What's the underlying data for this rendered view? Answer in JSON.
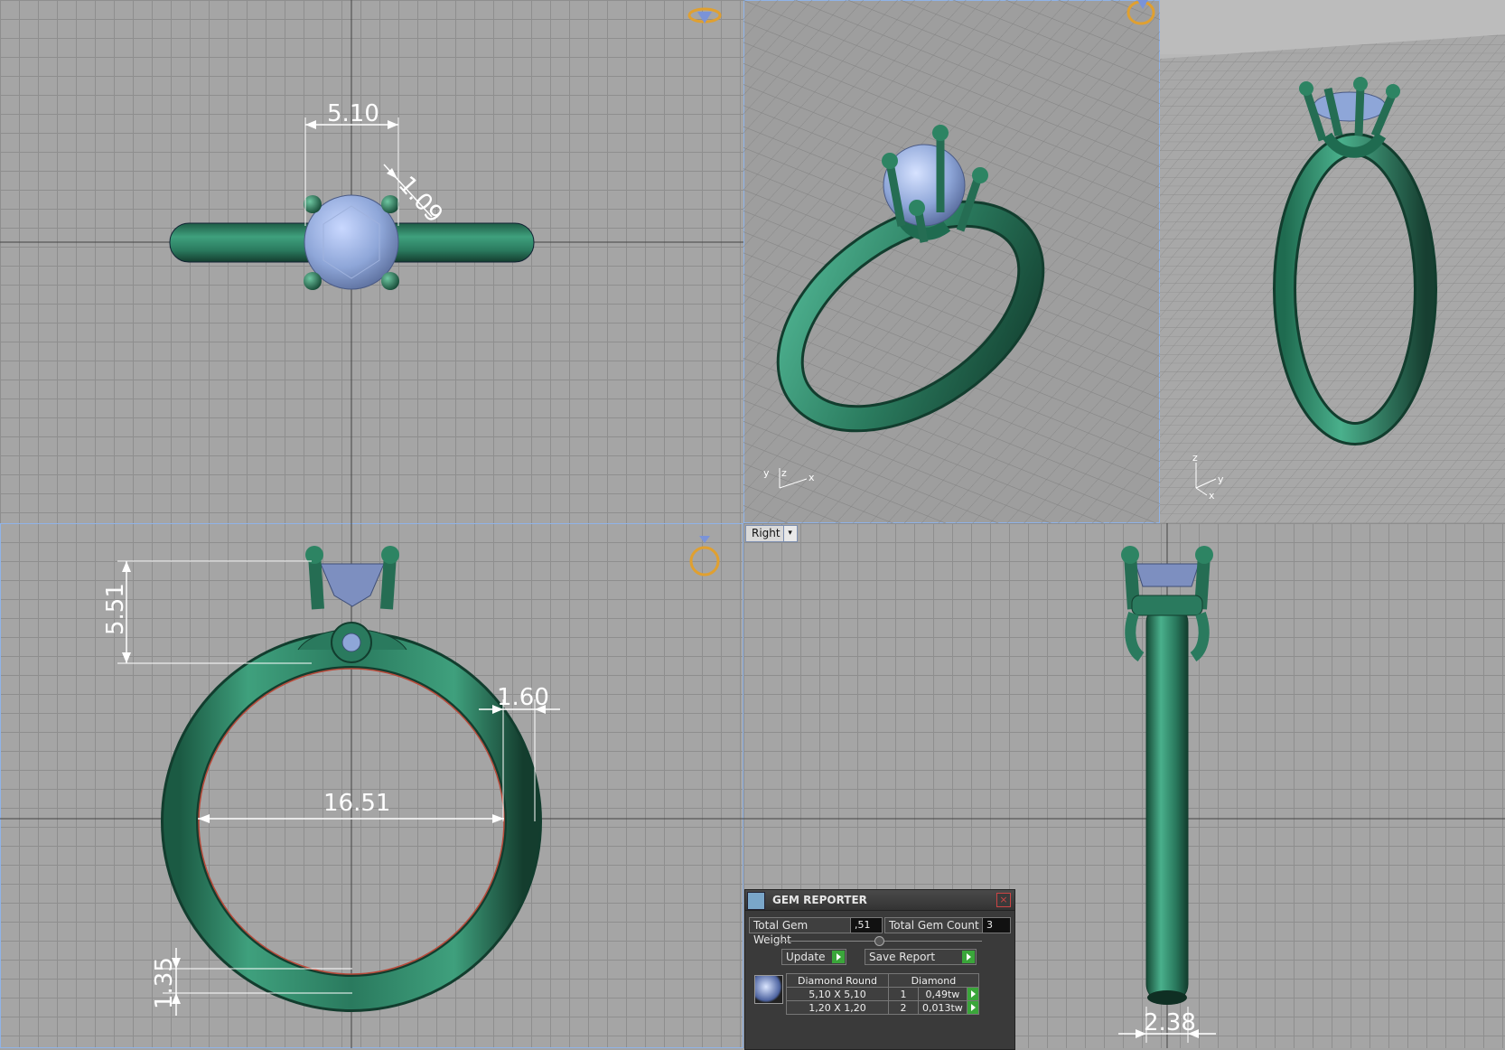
{
  "viewports": {
    "bottom_right": {
      "view_label": "Right",
      "dropdown_glyph": "▾"
    }
  },
  "dimensions": {
    "top_width": "5.10",
    "top_prong": "1.09",
    "front_height": "5.51",
    "front_shank": "1.60",
    "front_inner": "16.51",
    "front_bottom": "1.35",
    "side_bottom": "2.38"
  },
  "axes": {
    "persp1": {
      "y": "y",
      "z": "z",
      "x": "x"
    },
    "persp2": {
      "z": "z",
      "y": "y",
      "x": "x"
    }
  },
  "gem_reporter": {
    "title": "GEM REPORTER",
    "close": "×",
    "total_weight_label": "Total Gem Weight",
    "total_weight_value": ",51",
    "total_count_label": "Total Gem Count",
    "total_count_value": "3",
    "update_label": "Update",
    "save_report_label": "Save Report",
    "table": {
      "headers": [
        "Diamond Round",
        "Diamond"
      ],
      "rows": [
        {
          "size": "5,10 X 5,10",
          "count": "1",
          "weight": "0,49tw"
        },
        {
          "size": "1,20 X 1,20",
          "count": "2",
          "weight": "0,013tw"
        }
      ]
    }
  },
  "colors": {
    "metal": "#2e8a6a",
    "gem": "#8fa6d6",
    "grid_bg": "#a5a5a5",
    "viewport_border": "#8fb3e8"
  }
}
